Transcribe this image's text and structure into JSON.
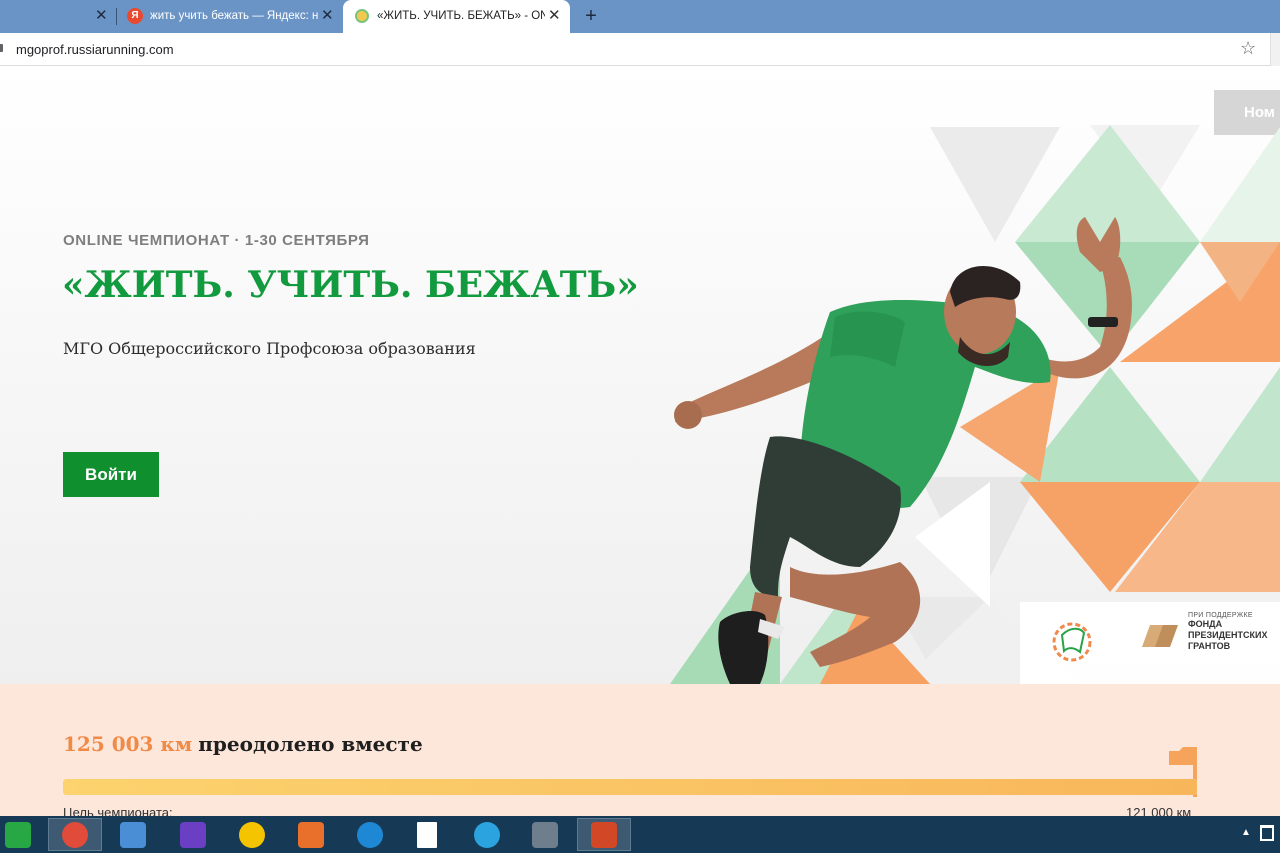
{
  "browser": {
    "tabs": [
      {
        "title": "",
        "active": false
      },
      {
        "title": "жить учить бежать — Яндекс: н",
        "favicon_letter": "Я",
        "active": false
      },
      {
        "title": "«ЖИТЬ. УЧИТЬ. БЕЖАТЬ» - ONL",
        "active": true
      }
    ],
    "new_tab_label": "+",
    "close_glyph": "✕",
    "url": "mgoprof.russiarunning.com"
  },
  "page": {
    "nomination_label": "Ном",
    "eyebrow": "ONLINE ЧЕМПИОНАТ · 1-30 СЕНТЯБРЯ",
    "headline": "«ЖИТЬ. УЧИТЬ. БЕЖАТЬ»",
    "subtitle": "МГО Общероссийского Профсоюза образования",
    "login_button": "Войти",
    "sponsor": {
      "small": "ПРИ ПОДДЕРЖКЕ",
      "line1": "ФОНДА",
      "line2": "ПРЕЗИДЕНТСКИХ",
      "line3": "ГРАНТОВ"
    }
  },
  "progress": {
    "km_value": "125 003 км",
    "km_text": "преодолено вместе",
    "goal_label": "Цель чемпионата:",
    "goal_value": "121 000 км",
    "fill_percent": 100
  },
  "colors": {
    "brand_green": "#129a3e",
    "button_green": "#0f8f2e",
    "accent_orange": "#f08a47",
    "progress_bg": "#fde6da"
  },
  "taskbar": {
    "items": [
      {
        "name": "start-button-icon",
        "color": "#27a845"
      },
      {
        "name": "chrome-icon",
        "color": "#e04b3a",
        "active": true
      },
      {
        "name": "control-panel-icon",
        "color": "#4a8fd6"
      },
      {
        "name": "settings-gear-icon",
        "color": "#6a3fc4"
      },
      {
        "name": "1c-icon",
        "color": "#f5c400"
      },
      {
        "name": "screenshot-tool-icon",
        "color": "#e8702a"
      },
      {
        "name": "edge-icon",
        "color": "#1e88d4"
      },
      {
        "name": "blank-document-icon",
        "color": "#ffffff"
      },
      {
        "name": "telegram-icon",
        "color": "#2aa3de"
      },
      {
        "name": "scanner-icon",
        "color": "#6f7e8c"
      },
      {
        "name": "powerpoint-icon",
        "color": "#d24726",
        "active": true
      }
    ],
    "tray_arrow": "▲"
  }
}
